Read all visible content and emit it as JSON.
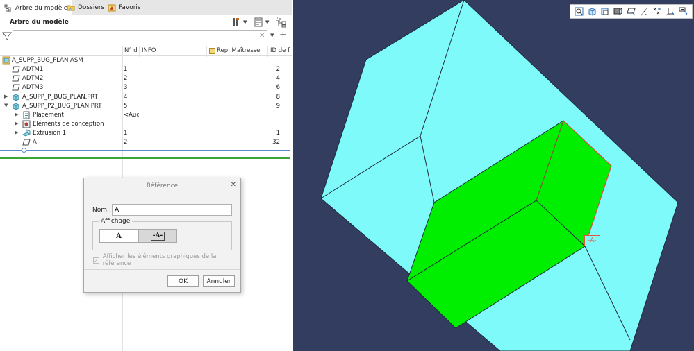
{
  "tabs": [
    {
      "label": "Arbre du modèle",
      "icon": "model-tree-icon",
      "active": true
    },
    {
      "label": "Dossiers",
      "icon": "folders-icon",
      "active": false
    },
    {
      "label": "Favoris",
      "icon": "favorites-icon",
      "active": false
    }
  ],
  "tree": {
    "title": "Arbre du modèle",
    "search": {
      "value": "",
      "placeholder": ""
    },
    "columns": [
      "N° d",
      "INFO",
      "Rep. Maîtresse",
      "ID de f"
    ],
    "rows": [
      {
        "name": "A_SUPP_BUG_PLAN.ASM",
        "num": "",
        "info": "",
        "id": "",
        "icon": "assembly-icon",
        "expander": ""
      },
      {
        "name": "ADTM1",
        "num": "1",
        "info": "",
        "id": "2",
        "icon": "datum-plane-icon",
        "expander": ""
      },
      {
        "name": "ADTM2",
        "num": "2",
        "info": "",
        "id": "4",
        "icon": "datum-plane-icon",
        "expander": ""
      },
      {
        "name": "ADTM3",
        "num": "3",
        "info": "",
        "id": "6",
        "icon": "datum-plane-icon",
        "expander": ""
      },
      {
        "name": "A_SUPP_P_BUG_PLAN.PRT",
        "num": "4",
        "info": "",
        "id": "8",
        "icon": "part-icon",
        "expander": "collapsed"
      },
      {
        "name": "A_SUPP_P2_BUG_PLAN.PRT",
        "num": "5",
        "info": "",
        "id": "9",
        "icon": "part-icon",
        "expander": "expanded"
      },
      {
        "name": "Placement",
        "num": "",
        "info": "<Auc",
        "id": "",
        "icon": "placement-icon",
        "expander": "collapsed"
      },
      {
        "name": "Eléments de conception",
        "num": "",
        "info": "",
        "id": "",
        "icon": "design-items-icon",
        "expander": "collapsed"
      },
      {
        "name": "Extrusion 1",
        "num": "1",
        "info": "",
        "id": "1",
        "icon": "extrude-icon",
        "expander": "collapsed"
      },
      {
        "name": "A",
        "num": "2",
        "info": "",
        "id": "32",
        "icon": "datum-plane-icon",
        "expander": ""
      }
    ]
  },
  "dialog": {
    "title": "Référence",
    "name_label": "Nom :",
    "name_value": "A",
    "display_group": "Affichage",
    "display_option_plain": "A",
    "display_option_framed": "-A-",
    "checkbox_label": "Afficher les éléments graphiques de la référence",
    "checkbox_checked": true,
    "checkbox_enabled": false,
    "ok": "OK",
    "cancel": "Annuler"
  },
  "viewport": {
    "datum_tag": "-A-",
    "toolbar_icons": [
      "refit-icon",
      "view-orientation-icon",
      "saved-views-icon",
      "display-style-icon",
      "datum-display-icon",
      "axis-display-icon",
      "point-display-icon",
      "csys-display-icon",
      "annotation-display-icon"
    ],
    "colors": {
      "background": "#333d60",
      "outer_block": "#7ffafa",
      "inner_block": "#00ee00",
      "highlight": "#e05a3a"
    }
  }
}
